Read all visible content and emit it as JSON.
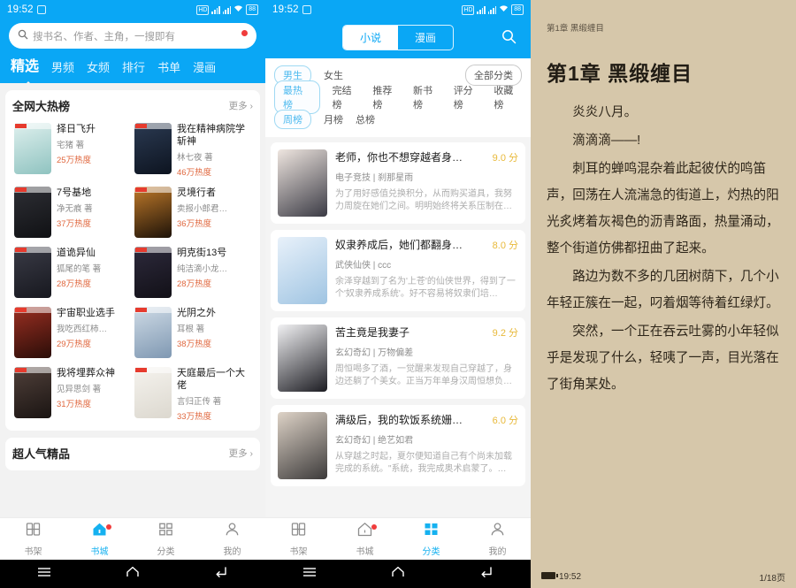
{
  "colors": {
    "brand_blue": "#0aa7f5",
    "accent_red": "#f03c3c",
    "heat_orange": "#e0683f",
    "score_yellow": "#e8b93a",
    "reader_bg": "#d6c7aa",
    "tab_active": "#15b1f0"
  },
  "status_bar": {
    "time": "19:52",
    "icons": [
      "hd-icon",
      "signal-4g-icon",
      "signal-4g-icon",
      "wifi-icon"
    ],
    "battery": "88"
  },
  "panel1": {
    "search": {
      "placeholder": "搜书名、作者、主角，一搜即有",
      "icon": "search-icon",
      "has_notification_dot": true
    },
    "nav_tabs": [
      {
        "label": "精选",
        "active": true
      },
      {
        "label": "男频",
        "active": false
      },
      {
        "label": "女频",
        "active": false
      },
      {
        "label": "排行",
        "active": false
      },
      {
        "label": "书单",
        "active": false
      },
      {
        "label": "漫画",
        "active": false
      }
    ],
    "section1": {
      "title": "全网大热榜",
      "more": "更多",
      "books": [
        {
          "title": "择日飞升",
          "author": "宅猪 著",
          "heat": "25万热度",
          "c1": "#dff0ee",
          "c2": "#8fc3c0"
        },
        {
          "title": "我在精神病院学斩神",
          "author": "林七夜 著",
          "heat": "46万热度",
          "c1": "#2b3a52",
          "c2": "#0d1420"
        },
        {
          "title": "7号基地",
          "author": "净无痕 著",
          "heat": "37万热度",
          "c1": "#2e2f35",
          "c2": "#101114"
        },
        {
          "title": "灵境行者",
          "author": "卖报小郎君…",
          "heat": "36万热度",
          "c1": "#c07a2a",
          "c2": "#1d1208"
        },
        {
          "title": "道诡异仙",
          "author": "狐尾的笔 著",
          "heat": "28万热度",
          "c1": "#3a3b46",
          "c2": "#17181f"
        },
        {
          "title": "明克街13号",
          "author": "纯洁滴小龙…",
          "heat": "28万热度",
          "c1": "#2d2a3c",
          "c2": "#121017"
        },
        {
          "title": "宇宙职业选手",
          "author": "我吃西红柿…",
          "heat": "29万热度",
          "c1": "#9b2f22",
          "c2": "#2a0d08"
        },
        {
          "title": "光阴之外",
          "author": "耳根 著",
          "heat": "38万热度",
          "c1": "#cfdbe6",
          "c2": "#7f98b2"
        },
        {
          "title": "我将埋葬众神",
          "author": "见异思剑 著",
          "heat": "31万热度",
          "c1": "#50403a",
          "c2": "#1a1412"
        },
        {
          "title": "天庭最后一个大佬",
          "author": "言归正传 著",
          "heat": "33万热度",
          "c1": "#f5f3ee",
          "c2": "#dcd8cf"
        }
      ]
    },
    "section2": {
      "title": "超人气精品",
      "more": "更多"
    },
    "tabbar": [
      {
        "label": "书架",
        "icon": "bookshelf-icon",
        "active": false,
        "dot": false
      },
      {
        "label": "书城",
        "icon": "home-icon",
        "active": true,
        "dot": true
      },
      {
        "label": "分类",
        "icon": "category-icon",
        "active": false,
        "dot": false
      },
      {
        "label": "我的",
        "icon": "person-icon",
        "active": false,
        "dot": false
      }
    ]
  },
  "panel2": {
    "segment": [
      {
        "label": "小说",
        "active": true
      },
      {
        "label": "漫画",
        "active": false
      }
    ],
    "search_icon": "search-icon",
    "filter_rows": [
      {
        "chips": [
          "男生"
        ],
        "items": [
          "女生"
        ],
        "right_chip": "全部分类"
      },
      {
        "chips": [
          "最热榜"
        ],
        "items": [
          "完结榜",
          "推荐榜",
          "新书榜",
          "评分榜",
          "收藏榜"
        ],
        "right_chip": ""
      },
      {
        "chips": [
          "周榜"
        ],
        "items": [
          "月榜",
          "总榜"
        ],
        "right_chip": ""
      }
    ],
    "books": [
      {
        "title": "老师，你也不想穿越者身…",
        "score": "9.0 分",
        "category": "电子竞技 | 刹那星雨",
        "desc": "为了用好感值兑换积分，从而购买道具，我努力周旋在她们之间。明明始终将关系压制在…",
        "c1": "#efe6e0",
        "c2": "#3a3a44"
      },
      {
        "title": "奴隶养成后，她们都翻身…",
        "score": "8.0 分",
        "category": "武侠仙侠 | ccc",
        "desc": "余泽穿越到了名为'上苍'的仙侠世界，得到了一个'奴隶养成系统'。好不容易将奴隶们培…",
        "c1": "#e8f1fa",
        "c2": "#9fc4e2"
      },
      {
        "title": "苦主竟是我妻子",
        "score": "9.2 分",
        "category": "玄幻奇幻 | 万物偏差",
        "desc": "周恒喝多了酒，一觉醒来发现自己穿越了，身边还躺了个美女。正当万年单身汉周恒想负…",
        "c1": "#f2f2f4",
        "c2": "#1c1c22"
      },
      {
        "title": "满级后，我的软饭系统姗…",
        "score": "6.0 分",
        "category": "玄幻奇幻 | 绝艺如君",
        "desc": "从穿越之时起，夏尔便知道自己有个尚未加载完成的系统。\"系统，我完成奥术启蒙了。…",
        "c1": "#ded3c7",
        "c2": "#3c3a3a"
      }
    ],
    "tabbar": [
      {
        "label": "书架",
        "icon": "bookshelf-icon",
        "active": false,
        "dot": false
      },
      {
        "label": "书城",
        "icon": "home-icon",
        "active": false,
        "dot": true
      },
      {
        "label": "分类",
        "icon": "category-icon",
        "active": true,
        "dot": false
      },
      {
        "label": "我的",
        "icon": "person-icon",
        "active": false,
        "dot": false
      }
    ]
  },
  "panel3": {
    "header_chapter": "第1章 黑缎缠目",
    "chapter_title": "第1章 黑缎缠目",
    "paragraphs": [
      "炎炎八月。",
      "滴滴滴——!",
      "刺耳的蝉鸣混杂着此起彼伏的鸣笛声，回荡在人流湍急的街道上，灼热的阳光炙烤着灰褐色的沥青路面，热量涌动，整个街道仿佛都扭曲了起来。",
      "路边为数不多的几团树荫下，几个小年轻正簇在一起，叼着烟等待着红绿灯。",
      "突然，一个正在吞云吐雾的小年轻似乎是发现了什么，轻咦了一声，目光落在了街角某处。"
    ],
    "footer": {
      "time": "19:52",
      "page": "1/18页",
      "battery_icon": "battery-icon"
    }
  }
}
